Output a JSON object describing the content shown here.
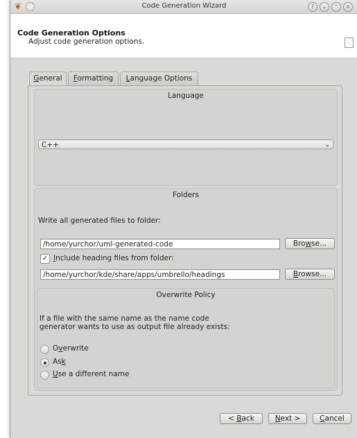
{
  "window": {
    "title": "Code Generation Wizard",
    "app_icon": "umbrello-icon",
    "buttons": [
      "help",
      "minimize",
      "maximize",
      "close"
    ]
  },
  "header": {
    "title": "Code Generation Options",
    "subtitle": "Adjust code generation options."
  },
  "tabs": [
    {
      "label": "General",
      "mnemonic": "G",
      "rest": "eneral",
      "active": true
    },
    {
      "label": "Formatting",
      "mnemonic": "F",
      "rest": "ormatting",
      "active": false
    },
    {
      "label": "Language Options",
      "mnemonic": "L",
      "rest": "anguage Options",
      "active": false
    }
  ],
  "language": {
    "title": "Language",
    "selected": "C++"
  },
  "folders": {
    "title": "Folders",
    "write_label": "Write all generated files to folder:",
    "output_folder": "/home/yurchor/uml-generated-code",
    "browse_pre": "Bro",
    "browse_mn": "w",
    "browse_post": "se...",
    "include_checked": true,
    "include_mn": "I",
    "include_rest": "nclude heading files from folder:",
    "heading_folder": "/home/yurchor/kde/share/apps/umbrello/headings",
    "browse2_mn": "B",
    "browse2_post": "rowse..."
  },
  "overwrite": {
    "title": "Overwrite Policy",
    "description_line1": "If a file with the same name as the name code",
    "description_line2": "generator wants to use as output file already exists:",
    "options": [
      {
        "pre": "O",
        "mn": "v",
        "post": "erwrite",
        "selected": false
      },
      {
        "pre": "As",
        "mn": "k",
        "post": "",
        "selected": true
      },
      {
        "pre": "",
        "mn": "U",
        "post": "se a different name",
        "selected": false
      }
    ]
  },
  "footer": {
    "back_mn": "B",
    "back_post": "ack",
    "back_prefix": "< ",
    "next_mn": "N",
    "next_post": "ext >",
    "cancel_mn": "C",
    "cancel_post": "ancel"
  }
}
